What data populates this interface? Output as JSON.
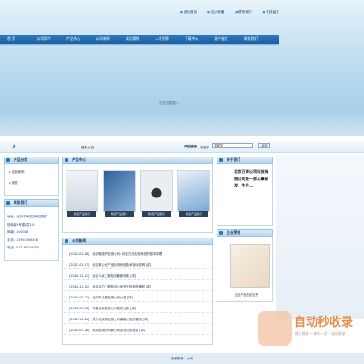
{
  "top_links": [
    "设为首页",
    "加入收藏",
    "联系我们",
    "在线留言"
  ],
  "nav": [
    "首 页",
    "公司简介",
    "产品中心",
    "公司新闻",
    "成功案例",
    "人才招聘",
    "下载中心",
    "客户留言",
    "联系我们"
  ],
  "loading_text": "正在加载图片...",
  "notice_label": "最新公告",
  "search": {
    "label": "产品搜索",
    "kw_label": "关键字",
    "kw_value": "关键字",
    "button": "搜索"
  },
  "left": {
    "category_title": "产品分类",
    "categories": [
      "应用案例",
      "其他"
    ],
    "contact_title": "联系我们",
    "contact_lines": [
      "地址：北京市海淀区海淀路学",
      "院南路5号楼1层101",
      "邮编：100048",
      "手机：13901066466",
      "电话：010-68209200"
    ]
  },
  "products": {
    "title": "产品中心",
    "captions": [
      "精选产品展示",
      "精选产品展示",
      "精选产品展示",
      "精选产品展示"
    ]
  },
  "news": {
    "title": "公司新闻",
    "items": [
      {
        "date": "[2022-02-08]",
        "text": "北京微波炉检测公司: 标准方法检测系统的基本原理"
      },
      {
        "date": "[2021-01-07]",
        "text": "北京某公司产品检测系统技术指标说明 [详]"
      },
      {
        "date": "[2014-11-21]",
        "text": "北京人民工程检测最新标准 [详]"
      },
      {
        "date": "[2014-11-12]",
        "text": "北京活力工程检测公司关于检测的通知 [详]"
      },
      {
        "date": "[2014-05-22]",
        "text": "北京市工程检测公司公告 [详]"
      },
      {
        "date": "[2013-05-08]",
        "text": "中国北京检测公司发布公告 [详]"
      },
      {
        "date": "[2012-12-20]",
        "text": "关于北京某检测公司最新公告的通知 [详]"
      },
      {
        "date": "[2012-07-26]",
        "text": "北京检测公司新公司发布公告信息 [详]"
      }
    ]
  },
  "about": {
    "title": "关于我们",
    "text": "北京万得公司科技有限公司是一家从事研发、生产..."
  },
  "honor": {
    "title": "企业荣誉",
    "caption": "企业产品鉴定证书"
  },
  "footer": "版权所有：公司",
  "watermark": {
    "text": "自动秒收录",
    "sub": "做上链接 一来访一次 一自动收录"
  },
  "colors": {
    "nav": "#1e5f9f",
    "accent": "#2a76b9",
    "watermark": "#e47a2e"
  }
}
